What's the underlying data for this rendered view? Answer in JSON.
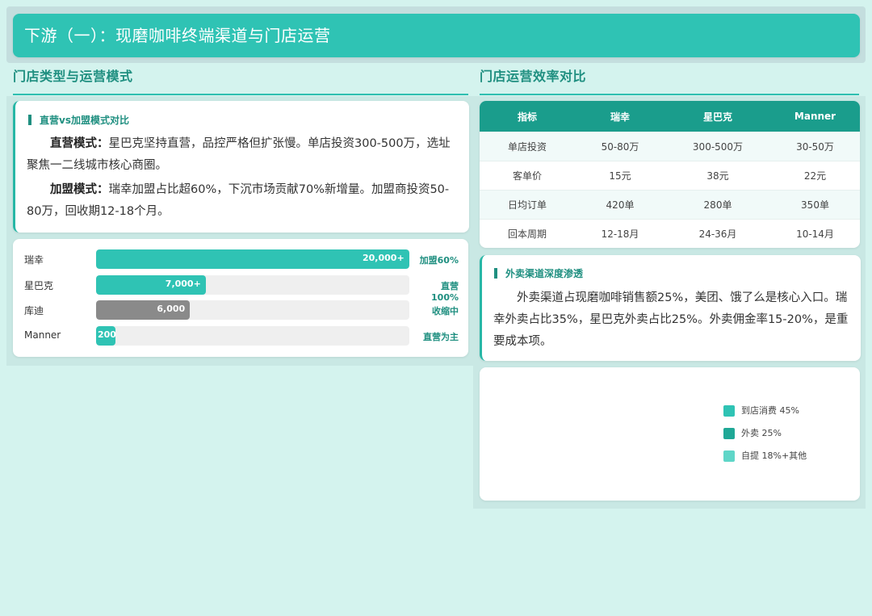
{
  "header": {
    "title": "下游（一）：现磨咖啡终端渠道与门店运营"
  },
  "left": {
    "section_title": "门店类型与运营模式",
    "model_card": {
      "heading": "直营vs加盟模式对比",
      "p1_label": "直营模式：",
      "p1_text": "星巴克坚持直营，品控严格但扩张慢。单店投资300-500万，选址聚焦一二线城市核心商圈。",
      "p2_label": "加盟模式：",
      "p2_text": "瑞幸加盟占比超60%，下沉市场贡献70%新增量。加盟商投资50-80万，回收期12-18个月。"
    }
  },
  "chart_data": [
    {
      "type": "bar",
      "orientation": "horizontal",
      "categories": [
        "瑞幸",
        "星巴克",
        "库迪",
        "Manner"
      ],
      "values": [
        20000,
        7000,
        6000,
        200
      ],
      "value_labels": [
        "20,000+",
        "7,000+",
        "6,000",
        "200"
      ],
      "tags": [
        "加盟60%",
        "直营100%",
        "收缩中",
        "直营为主"
      ],
      "colors": [
        "#2fc3b4",
        "#2fc3b4",
        "#8a8a8a",
        "#2fc3b4"
      ],
      "xlim": [
        0,
        20000
      ]
    },
    {
      "type": "pie",
      "legend": [
        "到店消费 45%",
        "外卖 25%",
        "自提 18%+其他"
      ],
      "colors": [
        "#2fc3b4",
        "#1fa896",
        "#5fd6c8"
      ],
      "legend_position": "right"
    }
  ],
  "right": {
    "section_title": "门店运营效率对比",
    "table": {
      "headers": [
        "指标",
        "瑞幸",
        "星巴克",
        "Manner"
      ],
      "rows": [
        [
          "单店投资",
          "50-80万",
          "300-500万",
          "30-50万"
        ],
        [
          "客单价",
          "15元",
          "38元",
          "22元"
        ],
        [
          "日均订单",
          "420单",
          "280单",
          "350单"
        ],
        [
          "回本周期",
          "12-18月",
          "24-36月",
          "10-14月"
        ]
      ]
    },
    "delivery_card": {
      "heading": "外卖渠道深度渗透",
      "text": "外卖渠道占现磨咖啡销售额25%，美团、饿了么是核心入口。瑞幸外卖占比35%，星巴克外卖占比25%。外卖佣金率15-20%，是重要成本项。"
    }
  },
  "colors": {
    "accent": "#2fc3b4",
    "accent_dark": "#1a9d8c",
    "background": "#d4f3ee"
  }
}
